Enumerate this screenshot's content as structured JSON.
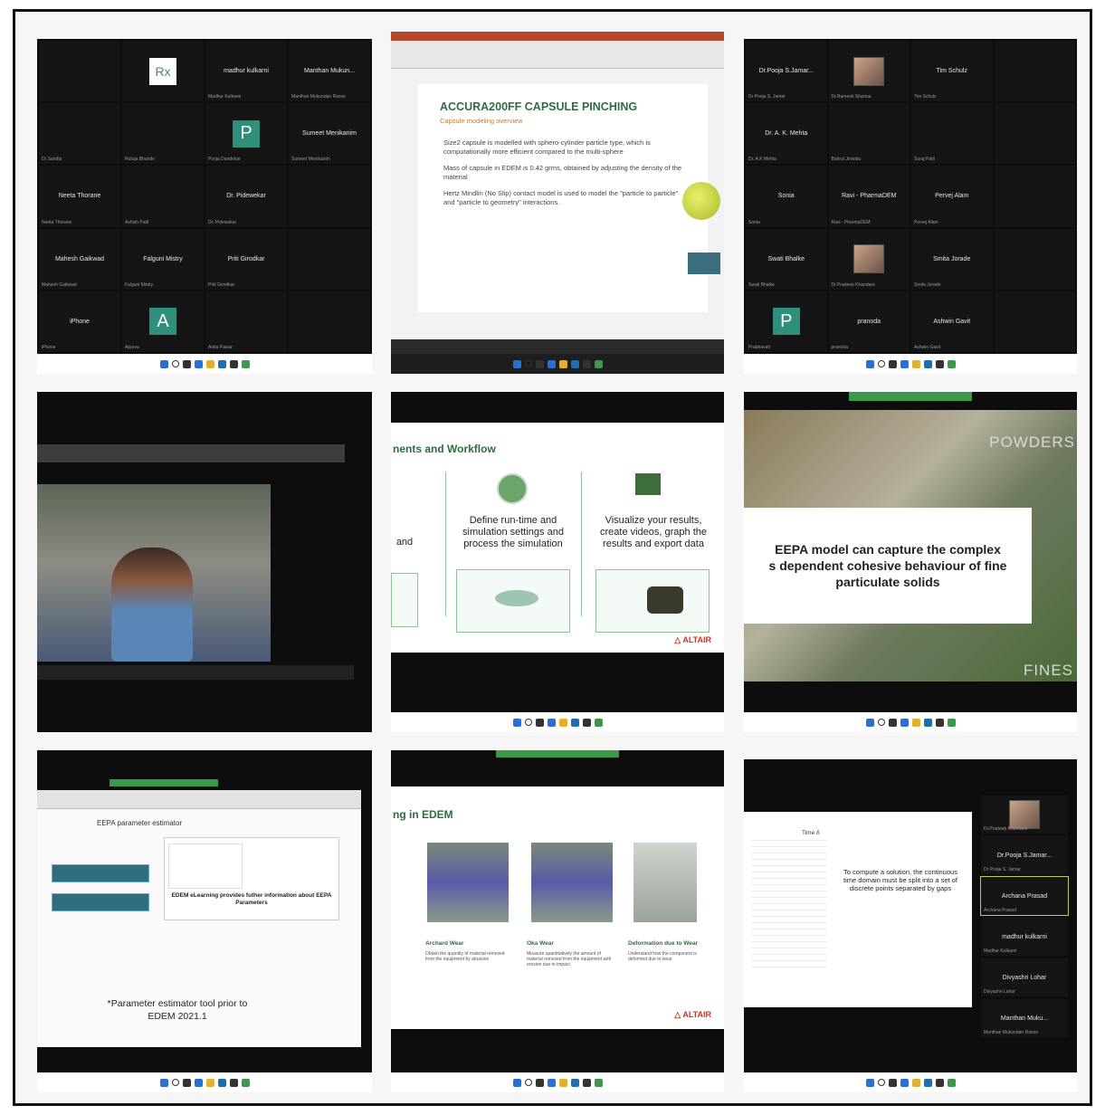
{
  "tile1": {
    "participants": [
      {
        "name": "",
        "sub": ""
      },
      {
        "name": "",
        "sub": "",
        "avatar": "Rx"
      },
      {
        "name": "madhur kulkarni",
        "sub": "Madhur Kulkarni"
      },
      {
        "name": "Manthan Mukun...",
        "sub": "Manthan Mukundan Rasne"
      },
      {
        "name": "",
        "sub": "Dr Sandip"
      },
      {
        "name": "",
        "sub": "Rutuja Bhande"
      },
      {
        "name": "P",
        "sub": "Pooja Dandekar",
        "avatar": "P"
      },
      {
        "name": "Sumeet Menikanim",
        "sub": "Sumeet Menikanim"
      },
      {
        "name": "Neeta Thorane",
        "sub": "Neeta Thorane"
      },
      {
        "name": "",
        "sub": "Ashish Patil"
      },
      {
        "name": "Dr. Pidewekar",
        "sub": "Dr. Pidewekar"
      },
      {
        "name": "",
        "sub": ""
      },
      {
        "name": "Mahesh Gaikwad",
        "sub": "Mahesh Gaikwad"
      },
      {
        "name": "Falguni Mistry",
        "sub": "Falguni Mistry"
      },
      {
        "name": "Priti Girodkar",
        "sub": "Priti Girodkar"
      },
      {
        "name": "",
        "sub": ""
      },
      {
        "name": "iPhone",
        "sub": "iPhone"
      },
      {
        "name": "A",
        "sub": "Apurva",
        "avatar": "A"
      },
      {
        "name": "",
        "sub": "Anita Pawar"
      },
      {
        "name": "",
        "sub": ""
      }
    ]
  },
  "tile2": {
    "title": "ACCURA200FF CAPSULE  PINCHING",
    "subtitle": "Capsule modeling overview",
    "bullets": [
      "Size2 capsule is modelled with sphero-cylinder particle type, which is computationally more efficient compared to the multi-sphere",
      "Mass of capsule in EDEM is 0.42 grms, obtained by adjusting the density of the material",
      "Hertz Mindlin (No Slip) contact model is used to model the \"particle to particle\" and \"particle to geometry\" interactions."
    ]
  },
  "tile3": {
    "participants": [
      {
        "name": "Dr.Pooja  S.Jamar...",
        "sub": "Dr Pooja S. Jamar"
      },
      {
        "name": "",
        "sub": "Dr.Ramesh Sharma",
        "photo": true
      },
      {
        "name": "Tim Schulz",
        "sub": "Tim Schulz"
      },
      {
        "name": "",
        "sub": ""
      },
      {
        "name": "Dr. A. K. Mehta",
        "sub": "Dr. A.K Mehta"
      },
      {
        "name": "",
        "sub": "Bahrul Jinwala"
      },
      {
        "name": "",
        "sub": "Suraj Patil"
      },
      {
        "name": "",
        "sub": ""
      },
      {
        "name": "Sonia",
        "sub": "Sonia"
      },
      {
        "name": "Ravi - PharmaDEM",
        "sub": "Ravi - PharmaDEM"
      },
      {
        "name": "Pervej Alam",
        "sub": "Pervej Alam"
      },
      {
        "name": "",
        "sub": ""
      },
      {
        "name": "Swati Bhalke",
        "sub": "Swati Bhalke"
      },
      {
        "name": "",
        "sub": "Dr.Pradeep Khandare",
        "photo": true
      },
      {
        "name": "Smita Jorade",
        "sub": "Smita Jorade"
      },
      {
        "name": "",
        "sub": ""
      },
      {
        "name": "P",
        "sub": "Prabhavati",
        "avatar": "P"
      },
      {
        "name": "pranoda",
        "sub": "pranoda"
      },
      {
        "name": "Ashwin Gavit",
        "sub": "Ashwin Gavit"
      },
      {
        "name": "",
        "sub": ""
      }
    ]
  },
  "tile5": {
    "heading": "nents and Workflow",
    "left_fragment": "and",
    "col1": "Define run-time and simulation settings and process the simulation",
    "col2": "Visualize your results, create videos, graph the results and export data",
    "brand": "ALTAIR"
  },
  "tile6": {
    "top_label": "POWDERS",
    "bottom_label": "FINES",
    "caption_line1": "EEPA model can capture the complex",
    "caption_line2": "s dependent cohesive behaviour of fine",
    "caption_line3": "particulate solids"
  },
  "tile7": {
    "title": "EEPA parameter estimator",
    "info": "EDEM eLearning provides futher information about EEPA Parameters",
    "footnote_line1": "*Parameter estimator tool prior to",
    "footnote_line2": "EDEM 2021.1"
  },
  "tile8": {
    "heading": "ng in EDEM",
    "cols": [
      {
        "title": "Archard Wear",
        "text": "Obtain the quantity of material removed from the equipment by abrasion"
      },
      {
        "title": "Oka Wear",
        "text": "Measure quantitatively the amount of material removed from the equipment with erosion due to impact"
      },
      {
        "title": "Deformation due to Wear",
        "text": "Understand how the component is deformed due to wear"
      }
    ],
    "brand": "ALTAIR"
  },
  "tile9": {
    "graph_label": "Time δ",
    "text": "To compute a solution, the continuous time domain must be split into a set of discrete points separated by gaps",
    "side": [
      {
        "name": "",
        "sub": "Dr.Pradeep Khandare",
        "photo": true
      },
      {
        "name": "Dr.Pooja  S.Jamar...",
        "sub": "Dr Pooja S. Jamar"
      },
      {
        "name": "Archana Prasad",
        "sub": "Archana Prasad",
        "active": true
      },
      {
        "name": "madhur kulkarni",
        "sub": "Madhur Kulkarni"
      },
      {
        "name": "Divyashri Lohar",
        "sub": "Divyashri Lohar"
      },
      {
        "name": "Manthan  Muku...",
        "sub": "Manthan Mukundan Rasne"
      }
    ]
  },
  "colors": {
    "taskbar_blue": "#2b6fd6",
    "altair_red": "#c0392b",
    "edem_green": "#2e7d46"
  },
  "icons": [
    "windows-icon",
    "search-icon",
    "taskview-icon",
    "chat-icon",
    "folder-icon",
    "edge-icon",
    "store-icon",
    "chrome-icon"
  ]
}
